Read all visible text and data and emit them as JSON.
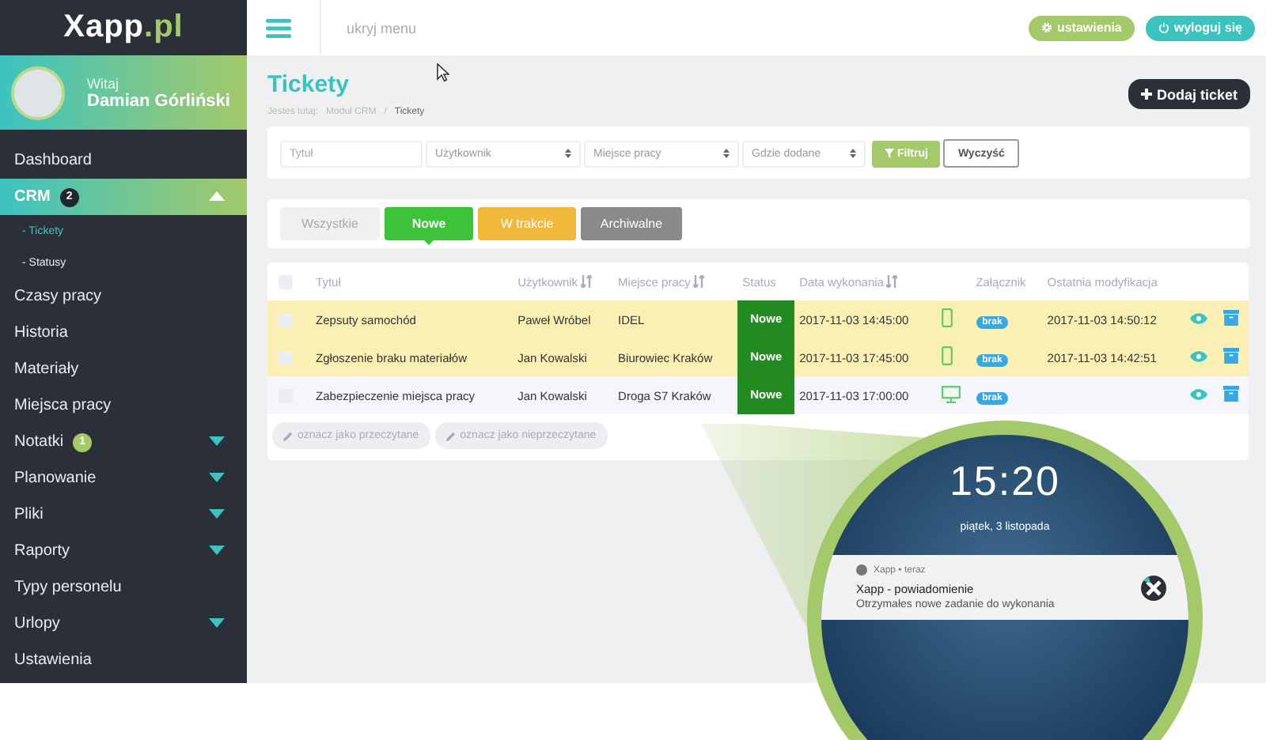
{
  "logo": {
    "name": "Xapp",
    "suffix": ".pl"
  },
  "user": {
    "greeting": "Witaj",
    "name": "Damian Górliński"
  },
  "topbar": {
    "menu_toggle": "ukryj menu",
    "settings": "ustawienia",
    "logout": "wyloguj się"
  },
  "sidebar": {
    "items": [
      {
        "label": "Dashboard",
        "selected": false
      },
      {
        "label": "CRM",
        "badge": "2",
        "color": "#22262d",
        "expanded": true,
        "selected": true,
        "children": [
          {
            "label": "- Tickety",
            "selected": true
          },
          {
            "label": "- Statusy",
            "selected": false
          }
        ]
      },
      {
        "label": "Czasy pracy",
        "selected": false
      },
      {
        "label": "Historia",
        "selected": false
      },
      {
        "label": "Materiały",
        "selected": false
      },
      {
        "label": "Miejsca pracy",
        "selected": false
      },
      {
        "label": "Notatki",
        "badge": "1",
        "color": "#a4c96a",
        "expanded": false,
        "selected": false
      },
      {
        "label": "Planowanie",
        "expanded": false,
        "selected": false
      },
      {
        "label": "Pliki",
        "expanded": false,
        "selected": false
      },
      {
        "label": "Raporty",
        "expanded": false,
        "selected": false
      },
      {
        "label": "Typy personelu",
        "selected": false
      },
      {
        "label": "Urlopy",
        "expanded": false,
        "selected": false
      },
      {
        "label": "Ustawienia",
        "selected": false
      }
    ]
  },
  "page": {
    "title": "Tickety",
    "breadcrumb": [
      "Jesteś tutaj:",
      "Moduł CRM",
      "/",
      "Tickety"
    ],
    "add_button": "Dodaj ticket"
  },
  "filters": {
    "fields": [
      {
        "kind": "input",
        "placeholder": "Tytuł"
      },
      {
        "kind": "select",
        "placeholder": "Użytkownik"
      },
      {
        "kind": "select",
        "placeholder": "Miejsce pracy"
      },
      {
        "kind": "select",
        "placeholder": "Gdzie dodane"
      }
    ],
    "filter_button": "Filtruj",
    "clear_button": "Wyczyść"
  },
  "status_tabs": [
    {
      "label": "Wszystkie",
      "selected": false,
      "color": "#eef0f2"
    },
    {
      "label": "Nowe",
      "selected": true,
      "color": "#3cc33a"
    },
    {
      "label": "W trakcie",
      "selected": false,
      "color": "#f0b93b"
    },
    {
      "label": "Archiwalne",
      "selected": false,
      "color": "#8a8a8a"
    }
  ],
  "table": {
    "columns": [
      {
        "label": "Tytuł",
        "sortable": false
      },
      {
        "label": "Użytkownik",
        "sortable": true
      },
      {
        "label": "Miejsce pracy",
        "sortable": true
      },
      {
        "label": "Status",
        "sortable": false
      },
      {
        "label": "Data wykonania",
        "sortable": true
      },
      {
        "sortable": false
      },
      {
        "label": "Załącznik",
        "sortable": false
      },
      {
        "label": "Ostatnia modyfikacja",
        "sortable": false
      }
    ],
    "all_checked": false,
    "rows": [
      {
        "checked": false,
        "unread": true,
        "title": "Zepsuty samochód",
        "user": "Paweł Wróbel",
        "place": "IDEL",
        "status": "Nowe",
        "date": "2017-11-03 14:45:00",
        "device": {
          "kind": "phone"
        },
        "attachment": "brak",
        "modified": "2017-11-03 14:50:12"
      },
      {
        "checked": false,
        "unread": true,
        "title": "Zgłoszenie braku materiałów",
        "user": "Jan Kowalski",
        "place": "Biurowiec Kraków",
        "status": "Nowe",
        "date": "2017-11-03 17:45:00",
        "device": {
          "kind": "phone"
        },
        "attachment": "brak",
        "modified": "2017-11-03 14:42:51"
      },
      {
        "checked": false,
        "unread": false,
        "title": "Zabezpieczenie miejsca pracy",
        "user": "Jan Kowalski",
        "place": "Droga S7 Kraków",
        "status": "Nowe",
        "date": "2017-11-03 17:00:00",
        "device": {
          "kind": "desktop"
        },
        "attachment": "brak"
      }
    ]
  },
  "bulk_actions": [
    "oznacz jako przeczytane",
    "oznacz jako nieprzeczytane"
  ],
  "phone": {
    "clock": "15:20",
    "date": "piątek, 3 listopada",
    "notification": {
      "app": "Xapp • teraz",
      "title": "Xapp - powiadomienie",
      "body": "Otrzymałes nowe zadanie do wykonania"
    }
  }
}
